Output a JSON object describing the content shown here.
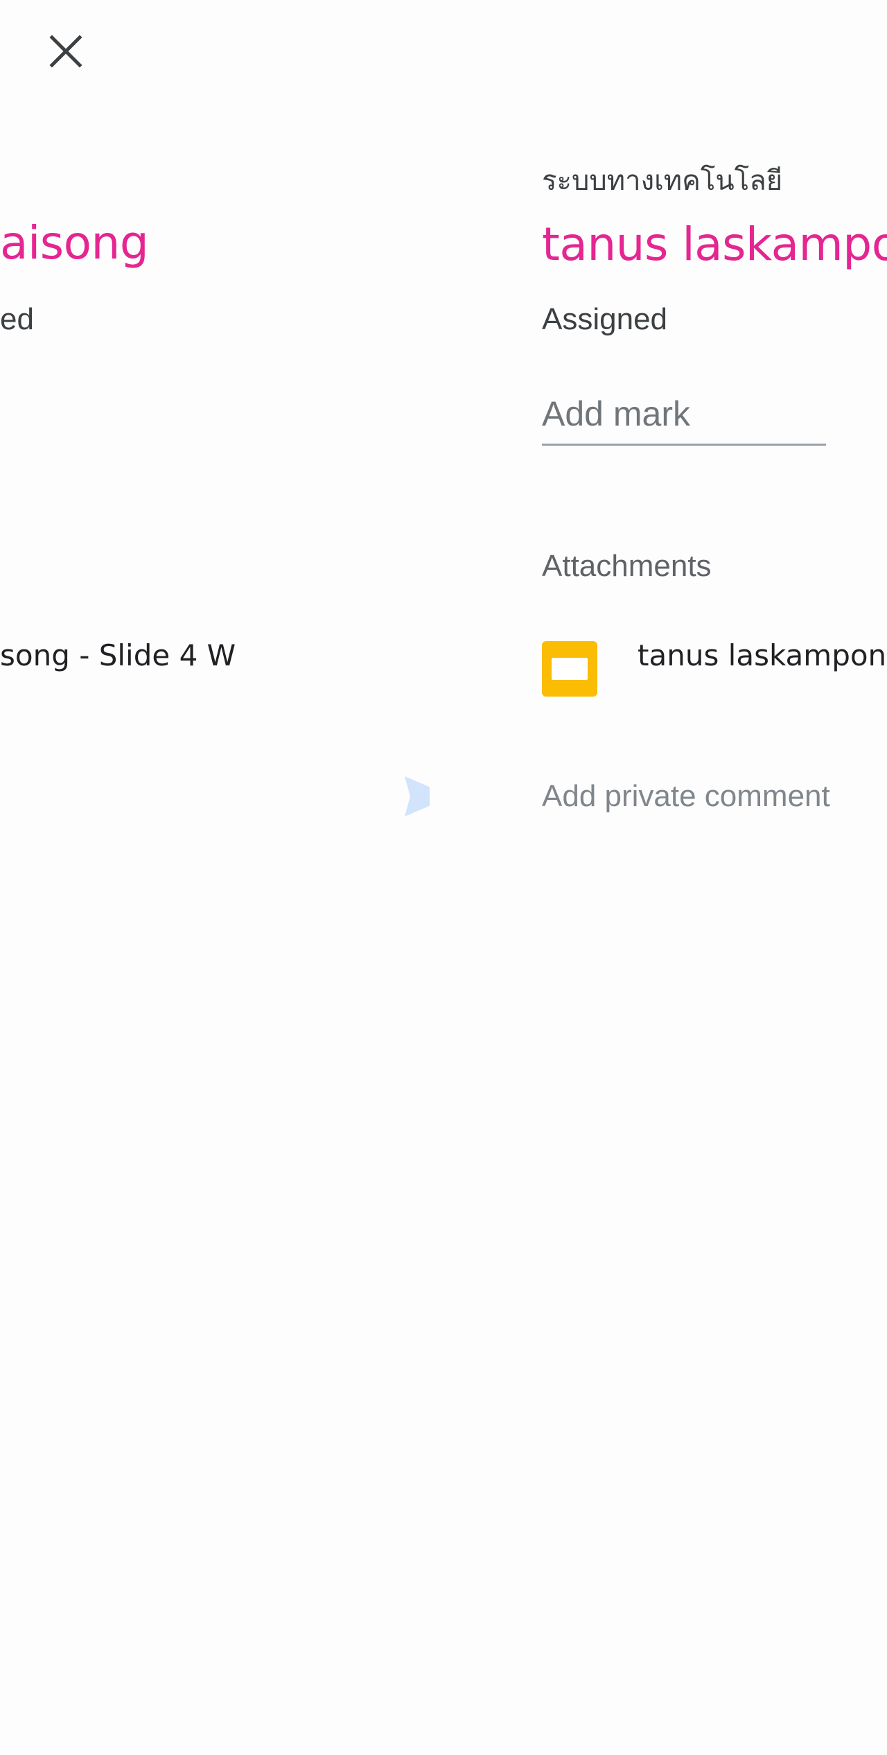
{
  "toolbar": {
    "close_icon": "close-icon"
  },
  "previous_student": {
    "name_fragment": "aisong",
    "status_fragment": "ed",
    "attachment_fragment": "song - Slide 4 W",
    "send_icon": "send-icon",
    "send_color": "#d2e3fc"
  },
  "current_student": {
    "course_title": "ระบบทางเทคโนโลยี",
    "name": "tanus laskampo",
    "status": "Assigned",
    "mark_placeholder": "Add mark",
    "attachments_label": "Attachments",
    "attachment": {
      "icon": "google-slides-icon",
      "name": "tanus laskampon"
    },
    "comment_placeholder": "Add private comment"
  },
  "colors": {
    "accent": "#e52592",
    "slides_icon": "#fbbc04",
    "background": "#fdfdfd"
  }
}
